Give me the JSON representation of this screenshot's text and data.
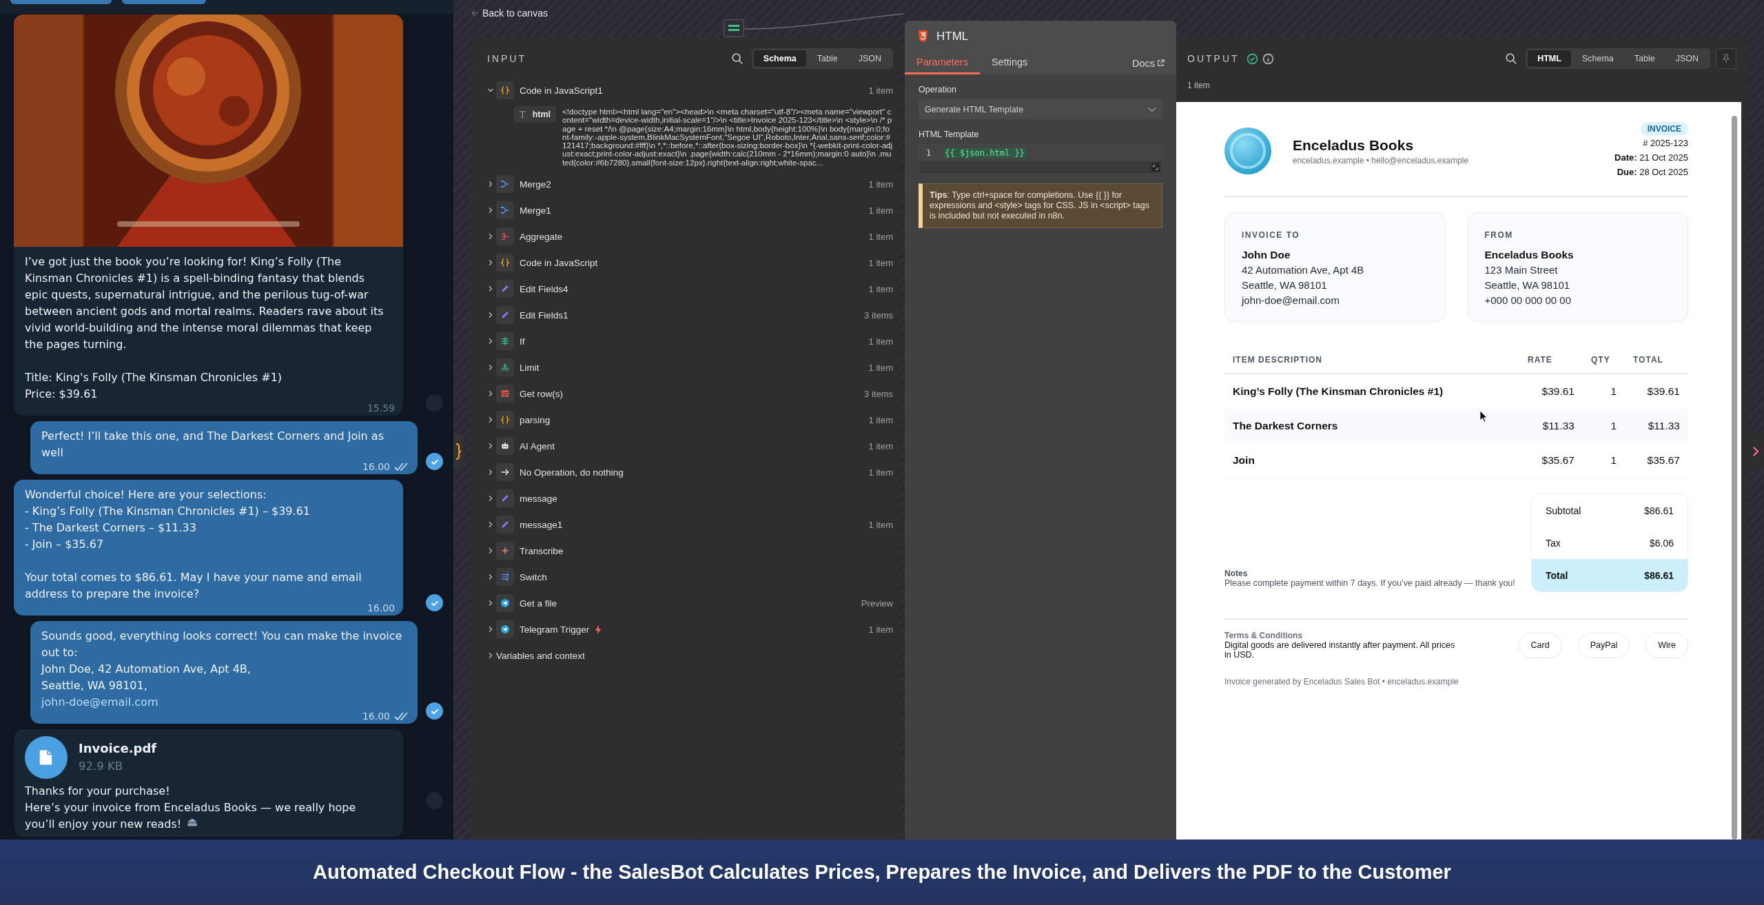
{
  "chat": {
    "messages": [
      {
        "kind": "bot",
        "selected": false,
        "text": "I’ve got just the book you’re looking for! King’s Folly (The Kinsman Chronicles #1) is a spell-binding fantasy that blends epic quests, supernatural intrigue, and the perilous tug-of-war between ancient gods and mortal realms. Readers rave about its vivid world-building and the intense moral dilemmas that keep the pages turning.\n\nTitle: King's Folly (The Kinsman Chronicles #1)\nPrice: $39.61",
        "time": "15.59"
      },
      {
        "kind": "user",
        "selected": true,
        "text": "Perfect! I’ll take this one, and The Darkest Corners and Join as well",
        "time": "16.00",
        "read": true
      },
      {
        "kind": "bot",
        "selected": true,
        "text": "Wonderful choice! Here are your selections:\n- King’s Folly (The Kinsman Chronicles #1) – $39.61\n- The Darkest Corners – $11.33\n- Join – $35.67\n\nYour total comes to $86.61. May I have your name and email address to prepare the invoice?",
        "time": "16.00"
      },
      {
        "kind": "user",
        "selected": true,
        "text": "Sounds good, everything looks correct! You can make the invoice out to:\nJohn Doe, 42 Automation Ave, Apt 4B,\nSeattle, WA 98101,",
        "link": "john-doe@email.com",
        "time": "16.00",
        "read": true
      },
      {
        "kind": "file",
        "selected": false,
        "file_name": "Invoice.pdf",
        "file_size": "92.9 KB",
        "text": "Thanks for your purchase!\nHere’s your invoice from Enceladus Books — we really hope you’ll enjoy your new reads!"
      }
    ]
  },
  "canvas": {
    "back_link": "Back to canvas"
  },
  "input": {
    "title": "INPUT",
    "views": [
      {
        "label": "Schema",
        "selected": true
      },
      {
        "label": "Table",
        "selected": false
      },
      {
        "label": "JSON",
        "selected": false
      }
    ],
    "nodes": [
      {
        "name": "Code in JavaScript1",
        "kind": "code",
        "count": "1 item",
        "expanded": true,
        "trigger": false,
        "fields": [
          {
            "type_symbol": "T",
            "key": "html",
            "value": "<!doctype html><html lang=\"en\"><head>\\n <meta charset=\"utf-8\"/><meta name=\"viewport\" content=\"width=device-width,initial-scale=1\"/>\\n <title>Invoice 2025-123</title>\\n <style>\\n /* page + reset */\\n @page{size:A4;margin:16mm}\\n html,body{height:100%}\\n body{margin:0;font-family:-apple-system,BlinkMacSystemFont,\"Segoe UI\",Roboto,Inter,Arial,sans-serif;color:#121417;background:#fff}\\n *,*::before,*::after{box-sizing:border-box}\\n *{-webkit-print-color-adjust:exact;print-color-adjust:exact}\\n .page{width:calc(210mm - 2*16mm);margin:0 auto}\\n .muted{color:#6b7280}.small{font-size:12px}.right{text-align:right;white-spac..."
          }
        ]
      },
      {
        "name": "Merge2",
        "kind": "merge",
        "count": "1 item",
        "expanded": false,
        "trigger": false
      },
      {
        "name": "Merge1",
        "kind": "merge",
        "count": "1 item",
        "expanded": false,
        "trigger": false
      },
      {
        "name": "Aggregate",
        "kind": "aggregate",
        "count": "1 item",
        "expanded": false,
        "trigger": false
      },
      {
        "name": "Code in JavaScript",
        "kind": "code",
        "count": "1 item",
        "expanded": false,
        "trigger": false
      },
      {
        "name": "Edit Fields4",
        "kind": "pencil",
        "count": "1 item",
        "expanded": false,
        "trigger": false
      },
      {
        "name": "Edit Fields1",
        "kind": "pencil",
        "count": "3 items",
        "expanded": false,
        "trigger": false
      },
      {
        "name": "If",
        "kind": "if",
        "count": "1 item",
        "expanded": false,
        "trigger": false
      },
      {
        "name": "Limit",
        "kind": "limit",
        "count": "1 item",
        "expanded": false,
        "trigger": false
      },
      {
        "name": "Get row(s)",
        "kind": "table",
        "count": "3 items",
        "expanded": false,
        "trigger": false
      },
      {
        "name": "parsing",
        "kind": "code",
        "count": "1 item",
        "expanded": false,
        "trigger": false
      },
      {
        "name": "AI Agent",
        "kind": "robot",
        "count": "1 item",
        "expanded": false,
        "trigger": false
      },
      {
        "name": "No Operation, do nothing",
        "kind": "arrow",
        "count": "1 item",
        "expanded": false,
        "trigger": false
      },
      {
        "name": "message",
        "kind": "pencil",
        "expanded": false,
        "trigger": false
      },
      {
        "name": "message1",
        "kind": "pencil",
        "count": "1 item",
        "expanded": false,
        "trigger": false
      },
      {
        "name": "Transcribe",
        "kind": "sparkle",
        "expanded": false,
        "trigger": false
      },
      {
        "name": "Switch",
        "kind": "switch",
        "expanded": false,
        "trigger": false
      },
      {
        "name": "Get a file",
        "kind": "telegram",
        "count": "Preview",
        "expanded": false,
        "trigger": false
      },
      {
        "name": "Telegram Trigger",
        "kind": "telegram",
        "count": "1 item",
        "expanded": false,
        "trigger": true
      }
    ],
    "footer": {
      "label": "Variables and context",
      "expanded": false
    }
  },
  "node_panel": {
    "title": "HTML",
    "tabs": [
      {
        "label": "Parameters",
        "selected": true
      },
      {
        "label": "Settings",
        "selected": false
      }
    ],
    "docs_link": "Docs",
    "operation": {
      "label": "Operation",
      "value": "Generate HTML Template"
    },
    "template": {
      "label": "HTML Template",
      "lines": [
        {
          "number": "1",
          "code": "{{ $json.html }}"
        }
      ]
    },
    "tip": "**Tips**: Type ctrl+space for completions. Use {{ }} for expressions and <style> tags for CSS. JS in <script> tags is included but not executed in n8n."
  },
  "output": {
    "title": "OUTPUT",
    "success": true,
    "count": "1 item",
    "views": [
      {
        "label": "HTML",
        "selected": true
      },
      {
        "label": "Schema",
        "selected": false
      },
      {
        "label": "Table",
        "selected": false
      },
      {
        "label": "JSON",
        "selected": false
      }
    ],
    "invoice": {
      "company": "Enceladus Books",
      "contact": "enceladus.example • hello@enceladus.example",
      "badge": "INVOICE",
      "number": "# 2025-123",
      "dates": [
        "**Date:** 21 Oct 2025",
        "**Due:** 28 Oct 2025"
      ],
      "parties": [
        {
          "heading": "INVOICE TO",
          "name": "John Doe",
          "lines": [
            "42 Automation Ave, Apt 4B",
            "Seattle, WA 98101",
            "john-doe@email.com"
          ]
        },
        {
          "heading": "FROM",
          "name": "Enceladus Books",
          "lines": [
            "123 Main Street",
            "Seattle, WA 98101",
            "+000 00 000 00 00"
          ]
        }
      ],
      "columns": [
        "ITEM DESCRIPTION",
        "RATE",
        "QTY",
        "TOTAL"
      ],
      "rows": [
        [
          "King’s Folly (The Kinsman Chronicles #1)",
          "$39.61",
          "1",
          "$39.61"
        ],
        [
          "The Darkest Corners",
          "$11.33",
          "1",
          "$11.33"
        ],
        [
          "Join",
          "$35.67",
          "1",
          "$35.67"
        ]
      ],
      "notes": {
        "heading": "Notes",
        "text": "Please complete payment within 7 days. If you’ve paid already — thank you!"
      },
      "totals": [
        {
          "kind": "normal",
          "label": "Subtotal",
          "value": "$86.61"
        },
        {
          "kind": "normal",
          "label": "Tax",
          "value": "$6.06"
        },
        {
          "kind": "grand",
          "label": "Total",
          "value": "$86.61"
        }
      ],
      "terms": {
        "heading": "Terms & Conditions",
        "text": "Digital goods are delivered instantly after payment. All prices in USD."
      },
      "payment_methods": [
        "Card",
        "PayPal",
        "Wire"
      ],
      "footer": "Invoice generated by Enceladus Sales Bot • enceladus.example"
    }
  },
  "caption": "Automated Checkout Flow - the SalesBot Calculates Prices, Prepares the Invoice, and Delivers the PDF to the Customer"
}
